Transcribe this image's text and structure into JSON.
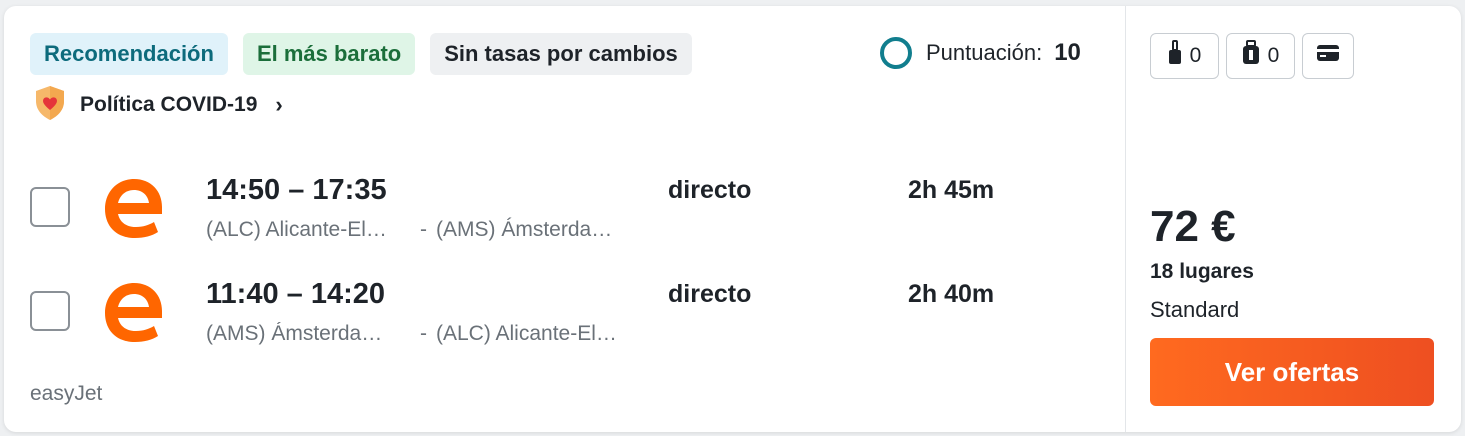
{
  "tags": {
    "recommendation": "Recomendación",
    "cheapest": "El más barato",
    "no_change_fees": "Sin tasas por cambios"
  },
  "score": {
    "label": "Puntuación:",
    "value": "10",
    "color": "#117e8e"
  },
  "covid": {
    "label": "Política COVID-19",
    "icon": "shield-heart-icon"
  },
  "flights": [
    {
      "times": "14:50 – 17:35",
      "origin": "(ALC) Alicante-El…",
      "separator": "-",
      "destination": "(AMS) Ámsterda…",
      "stops": "directo",
      "duration": "2h 45m"
    },
    {
      "times": "11:40 – 14:20",
      "origin": "(AMS) Ámsterda…",
      "separator": "-",
      "destination": "(ALC) Alicante-El…",
      "stops": "directo",
      "duration": "2h 40m"
    }
  ],
  "airline": {
    "name": "easyJet",
    "brand_color": "#ff6600"
  },
  "baggage": {
    "cabin_count": "0",
    "checked_count": "0",
    "icons": [
      "cabin-bag-icon",
      "checked-bag-icon",
      "card-icon"
    ]
  },
  "offer": {
    "price": "72 €",
    "seats": "18 lugares",
    "fare_class": "Standard",
    "cta_label": "Ver ofertas",
    "cta_color": "#f25a21"
  }
}
